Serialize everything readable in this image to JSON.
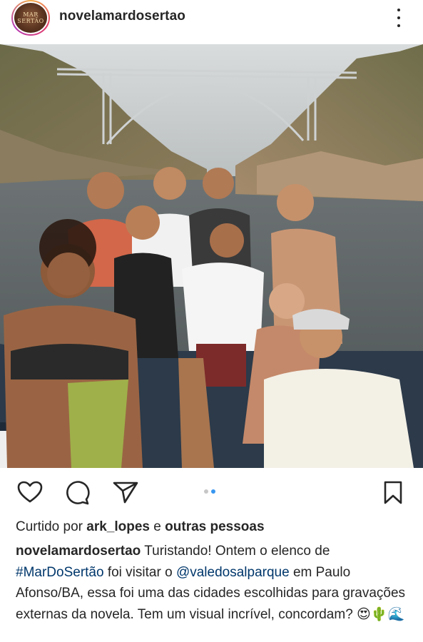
{
  "post": {
    "username": "novelamardosertao",
    "avatar_text": "MAR SERTÃO",
    "photo_alt": "",
    "carousel": {
      "count": 2,
      "active": 2
    },
    "likes": {
      "prefix": "Curtido por",
      "user": "ark_lopes",
      "conjunction": "e",
      "others": "outras pessoas"
    },
    "caption": {
      "author": "novelamardosertao",
      "text_1": " Turistando! Ontem o elenco de ",
      "hashtag": "#MarDoSertão",
      "text_2": " foi visitar o ",
      "mention": "@valedosalparque",
      "text_3": " em Paulo Afonso/BA, essa foi uma das cidades escolhidas para gravações externas da novela. Tem um visual incrível, concordam? ",
      "emojis": "😍🌵🌊"
    }
  },
  "icons": {
    "like": "heart-icon",
    "comment": "comment-icon",
    "share": "send-icon",
    "save": "bookmark-icon",
    "more": "more-icon"
  },
  "colors": {
    "text": "#262626",
    "link": "#00376b",
    "dot_active": "#3897f0",
    "dot_inactive": "#c7c7c7"
  }
}
